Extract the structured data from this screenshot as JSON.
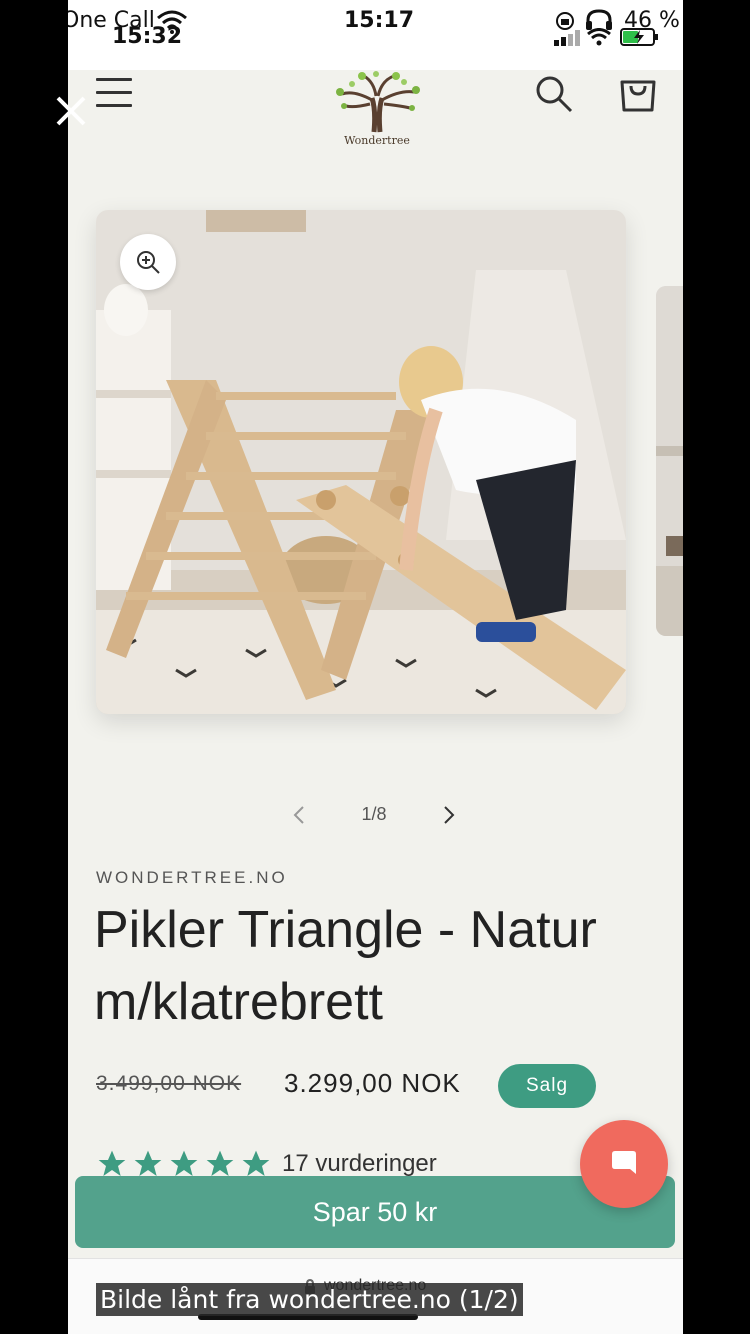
{
  "status_bar": {
    "carrier": "One Call",
    "time_left": "15:32",
    "time_center": "15:17",
    "battery": "46 %"
  },
  "header": {
    "logo_text": "Wondertree"
  },
  "gallery": {
    "counter": "1/8"
  },
  "product": {
    "vendor": "WONDERTREE.NO",
    "title": "Pikler Triangle - Natur m/klatrebrett",
    "price_old": "3.499,00 NOK",
    "price_new": "3.299,00 NOK",
    "sale_badge": "Salg",
    "rating": 5,
    "reviews": "17 vurderinger"
  },
  "cta": {
    "save_label": "Spar 50 kr"
  },
  "browser": {
    "url": "wondertree.no"
  },
  "caption": "Bilde lånt fra wondertree.no (1/2)",
  "colors": {
    "accent": "#53a28c",
    "badge": "#3e9c82",
    "chat": "#f06a5e",
    "background": "#f2f2ed"
  }
}
